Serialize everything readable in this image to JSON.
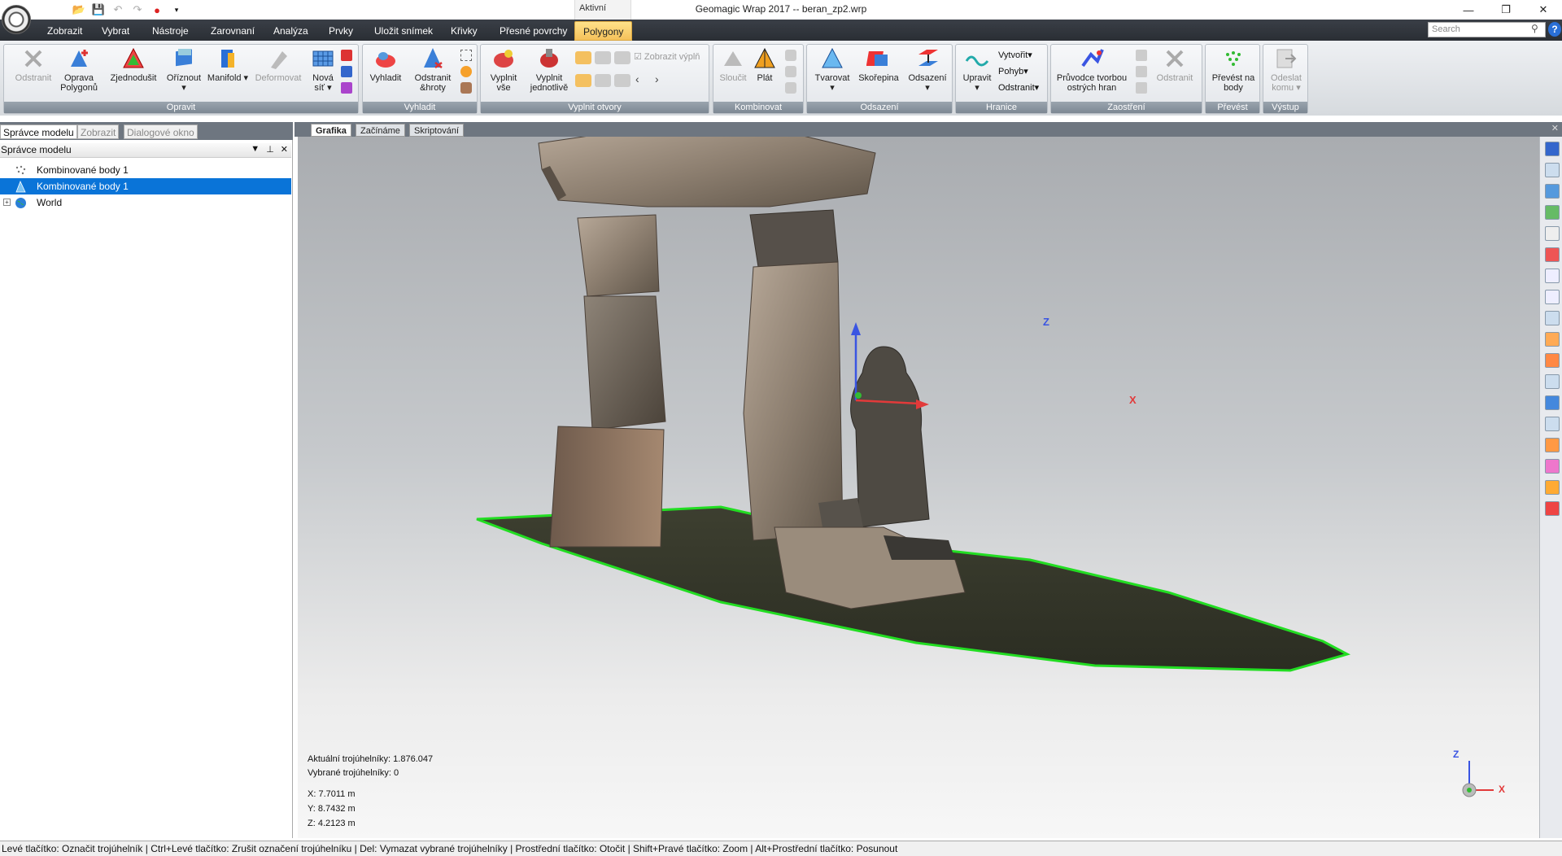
{
  "window": {
    "title": "Geomagic Wrap 2017 -- beran_zp2.wrp",
    "context_label": "Aktivní"
  },
  "ribbon_tabs": [
    "Zobrazit",
    "Vybrat",
    "Nástroje",
    "Zarovnaní",
    "Analýza",
    "Prvky",
    "Uložit snímek",
    "Křivky",
    "Přesné povrchy",
    "Polygony"
  ],
  "search": {
    "placeholder": "Search"
  },
  "ribbon": {
    "groups": {
      "opravit": "Opravit",
      "vyhladit": "Vyhladit",
      "vyplnit": "Vyplnit otvory",
      "kombinovat": "Kombinovat",
      "odsazeni": "Odsazení",
      "hranice": "Hranice",
      "zaostreni": "Zaostření",
      "prevest": "Převést",
      "vystup": "Výstup"
    },
    "buttons": {
      "odstranit": "Odstranit",
      "oprava1": "Oprava",
      "oprava2": "Polygonů",
      "zjednodusit": "Zjednodušit",
      "oriznout": "Oříznout",
      "manifold": "Manifold",
      "deformovat": "Deformovat",
      "nova1": "Nová",
      "nova2": "síť",
      "vyhladit": "Vyhladit",
      "odstranit_hroty1": "Odstranit",
      "odstranit_hroty2": "&hroty",
      "vyplnit_vse1": "Vyplnit",
      "vyplnit_vse2": "vše",
      "vyplnit_jed1": "Vyplnit",
      "vyplnit_jed2": "jednotlivě",
      "zobrazit_vyplne": "Zobrazit výplň",
      "sloucit": "Sloučit",
      "plat": "Plát",
      "tvarovat": "Tvarovat",
      "skorepina": "Skořepina",
      "odsazeni": "Odsazení",
      "upravit": "Upravit",
      "vytvorit": "Vytvořit",
      "pohyb": "Pohyb",
      "odstranit_h": "Odstranit",
      "pruvodce1": "Průvodce tvorbou",
      "pruvodce2": "ostrých hran",
      "odstranit_z": "Odstranit",
      "prevest1": "Převést na",
      "prevest2": "body",
      "odeslat1": "Odeslat",
      "odeslat2": "komu"
    }
  },
  "left_panel": {
    "tabs": [
      "Správce modelu",
      "Zobrazit",
      "Dialogové okno"
    ],
    "header": "Správce modelu",
    "tree": [
      {
        "label": "Kombinované body 1",
        "selected": false
      },
      {
        "label": "Kombinované body 1",
        "selected": true
      },
      {
        "label": "World",
        "selected": false
      }
    ]
  },
  "viewport_tabs": [
    "Grafika",
    "Začínáme",
    "Skriptování"
  ],
  "viewport": {
    "stats_current": "Aktuální trojúhelníky: 1.876.047",
    "stats_selected": "Vybrané trojúhelníky: 0",
    "x": "X:  7.7011 m",
    "y": "Y:  8.7432 m",
    "z": "Z:  4.2123 m",
    "axis_x": "X",
    "axis_z": "Z"
  },
  "statusbar": "Levé tlačítko: Označit trojúhelník | Ctrl+Levé tlačítko: Zrušit označení trojúhelníku | Del: Vymazat vybrané trojúhelníky | Prostřední tlačítko: Otočit | Shift+Pravé tlačítko: Zoom | Alt+Prostřední tlačítko: Posunout",
  "colors": {
    "active_tab": "#f5c15a",
    "selection": "#0a74d8",
    "mesh_boundary": "#22dd22",
    "axis_x": "#e23a3a",
    "axis_z": "#3a55e2"
  }
}
